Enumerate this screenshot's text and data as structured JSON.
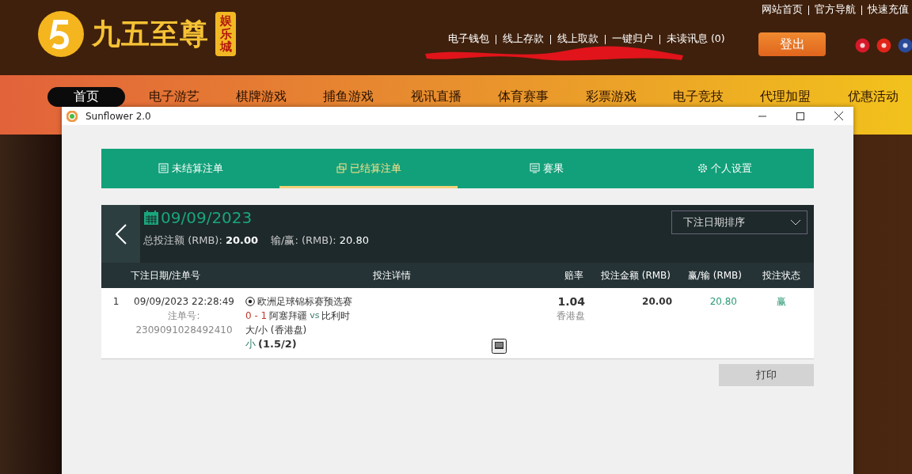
{
  "site": {
    "logo_text": "九五至尊",
    "logo_badge": "娱乐城",
    "top_links": [
      "网站首页",
      "官方导航",
      "快速充值"
    ],
    "account_links": [
      "电子钱包",
      "线上存款",
      "线上取款",
      "一键归户",
      "未读讯息 (0)"
    ],
    "logout": "登出",
    "nav": [
      {
        "label": "首页",
        "selected": true
      },
      {
        "label": "电子游艺",
        "selected": false
      },
      {
        "label": "棋牌游戏",
        "selected": false
      },
      {
        "label": "捕鱼游戏",
        "selected": false
      },
      {
        "label": "视讯直播",
        "selected": false
      },
      {
        "label": "体育赛事",
        "selected": false
      },
      {
        "label": "彩票游戏",
        "selected": false
      },
      {
        "label": "电子竞技",
        "selected": false
      },
      {
        "label": "代理加盟",
        "selected": false
      },
      {
        "label": "优惠活动",
        "selected": false
      }
    ]
  },
  "window": {
    "title": "Sunflower 2.0",
    "tabs": [
      {
        "label": "未结算注单",
        "kind": "ledger",
        "selected": false
      },
      {
        "label": "已结算注单",
        "kind": "coins",
        "selected": true
      },
      {
        "label": "赛果",
        "kind": "board",
        "selected": false
      },
      {
        "label": "个人设置",
        "kind": "gear",
        "selected": false
      }
    ],
    "summary": {
      "date": "09/09/2023",
      "total_label": "总投注额 (RMB):",
      "total_value": "20.00",
      "win_label": "输/赢: (RMB):",
      "win_value": "20.80"
    },
    "sort": {
      "value": "下注日期排序"
    },
    "columns": [
      "下注日期/注单号",
      "投注详情",
      "赔率",
      "投注金额 (RMB)",
      "赢/输 (RMB)",
      "投注状态"
    ],
    "rows": [
      {
        "index": "1",
        "datetime": "09/09/2023 22:28:49",
        "order_label": "注单号:",
        "order_no": "2309091028492410",
        "league": "欧洲足球锦标赛预选赛",
        "score": "0 - 1",
        "home": "阿塞拜疆",
        "vs": "vs",
        "away": "比利时",
        "market": "大/小 (香港盘)",
        "pick": "小",
        "line": "(1.5/2)",
        "odds": "1.04",
        "odds_type": "香港盘",
        "stake": "20.00",
        "result": "20.80",
        "status": "赢"
      }
    ],
    "print_button": "打印"
  }
}
